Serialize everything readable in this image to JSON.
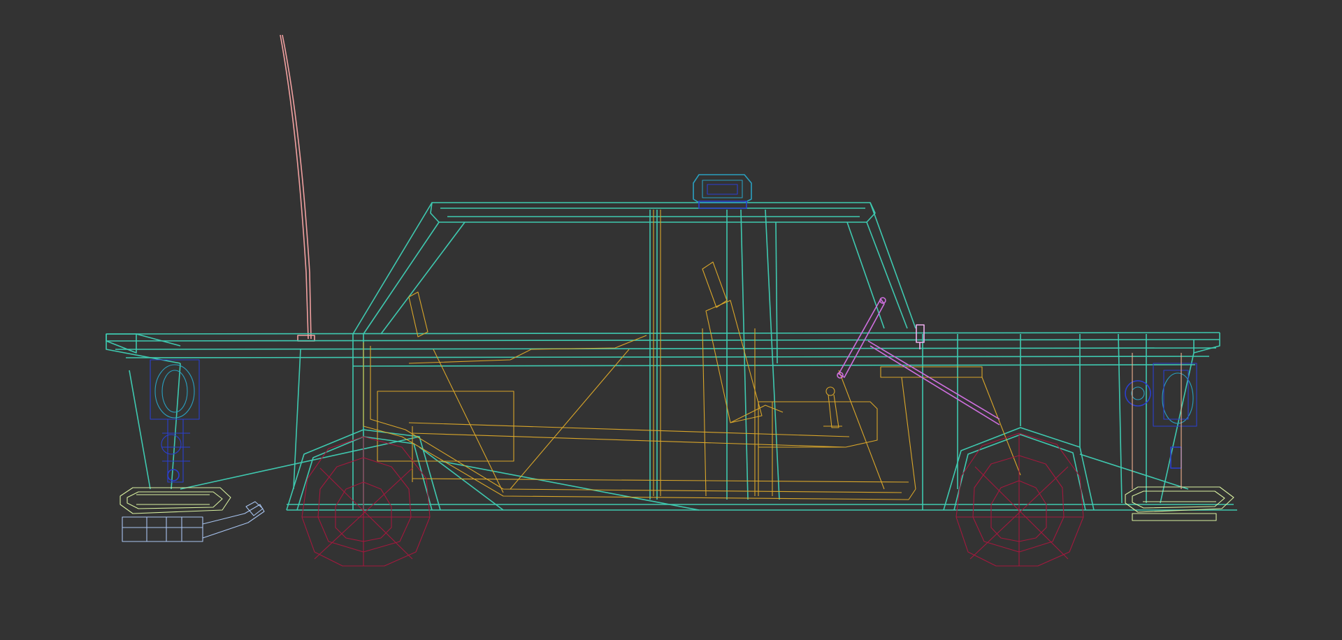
{
  "viewport": {
    "background": "#333333"
  },
  "colors": {
    "body": "#3fc9b0",
    "interior": "#d9a62a",
    "wheels": "#a3193e",
    "antenna": "#f0a0a0",
    "steering": "#d070e0",
    "parts_blue": "#2b3fd0",
    "parts_cyan": "#2aa0c0",
    "bumper": "#d8f0a0",
    "hitch": "#a8c4f0",
    "mirror": "#f0b0f0"
  },
  "objects": [
    {
      "name": "car-body-wireframe",
      "icon": "car-wireframe-icon"
    },
    {
      "name": "interior-frame",
      "icon": "frame-icon"
    },
    {
      "name": "front-wheel",
      "icon": "wheel-icon"
    },
    {
      "name": "rear-wheel",
      "icon": "wheel-icon"
    },
    {
      "name": "antenna",
      "icon": "antenna-icon"
    },
    {
      "name": "roof-light",
      "icon": "light-icon"
    },
    {
      "name": "steering-wheel",
      "icon": "steering-wheel-icon"
    },
    {
      "name": "gear-lever",
      "icon": "lever-icon"
    }
  ]
}
